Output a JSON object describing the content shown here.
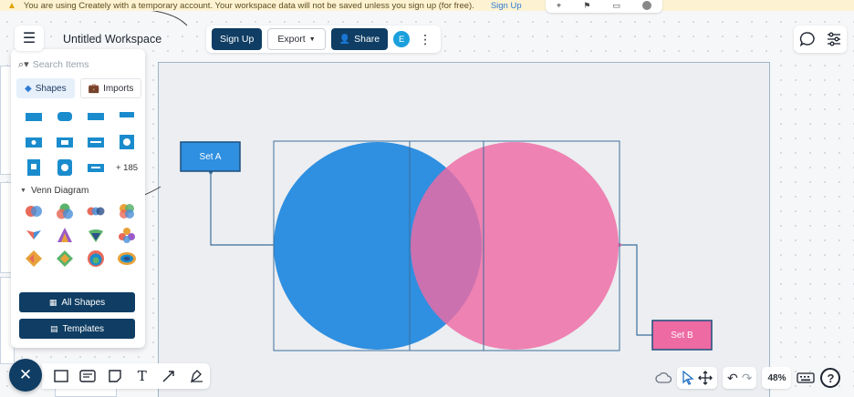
{
  "banner": {
    "message": "You are using Creately with a temporary account. Your workspace data will not be saved unless you sign up (for free).",
    "link": "Sign Up"
  },
  "header": {
    "title": "Untitled Workspace",
    "signup_label": "Sign Up",
    "export_label": "Export",
    "share_label": "Share",
    "avatar_initial": "E"
  },
  "panel": {
    "search_placeholder": "Search Items",
    "tabs": [
      {
        "label": "Shapes"
      },
      {
        "label": "Imports"
      }
    ],
    "more_count": "+ 185",
    "section_title": "Venn Diagram",
    "all_shapes_label": "All Shapes",
    "templates_label": "Templates"
  },
  "canvas": {
    "set_a_label": "Set A",
    "set_b_label": "Set B",
    "colors": {
      "circle_a": "#2f8fe0",
      "circle_b": "#ee6aa3",
      "label_a": "#2f8fe0",
      "label_b": "#ee6aa3"
    }
  },
  "bottom": {
    "zoom": "48%"
  },
  "colors": {
    "primary": "#0f3d63",
    "accent": "#1aa0dc"
  }
}
